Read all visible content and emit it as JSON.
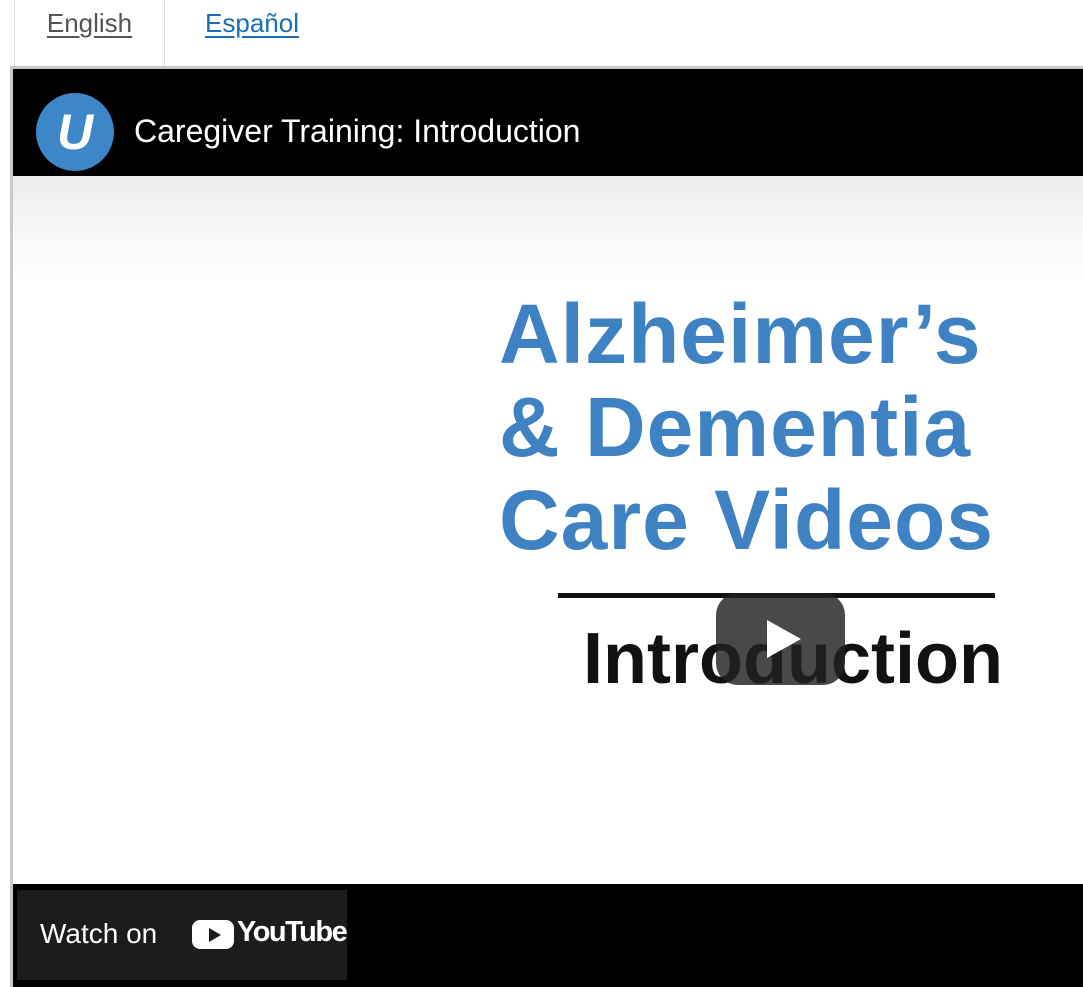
{
  "tabs": {
    "english": "English",
    "espanol": "Español"
  },
  "player": {
    "channel_logo_letter": "U",
    "title": "Caregiver Training: Introduction",
    "slide": {
      "line1": "Alzheimer’s",
      "line2": "& Dementia",
      "line3": "Care Videos",
      "subtitle": "Introduction"
    },
    "watch_on_label": "Watch on",
    "youtube_wordmark": "YouTube",
    "icons": {
      "logo": "channel-logo-icon",
      "play": "play-icon",
      "youtube": "youtube-icon"
    }
  },
  "colors": {
    "link": "#1b6eb5",
    "slide_blue": "#3f82c4",
    "logo_blue": "#3d86c7",
    "bar": "#000000"
  }
}
